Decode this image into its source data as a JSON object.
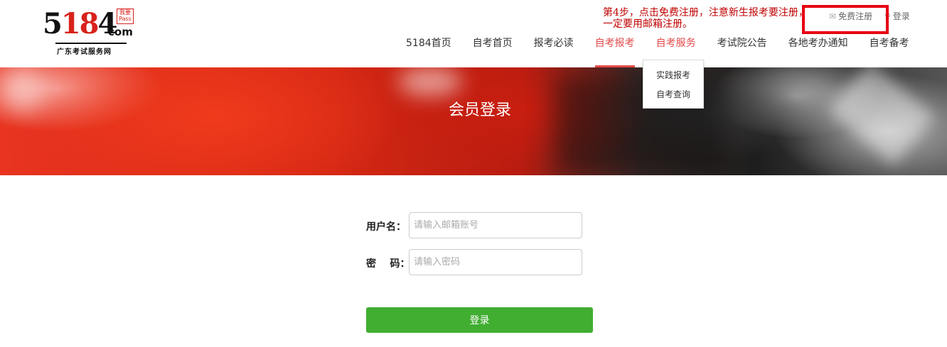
{
  "logo": {
    "digits_black_1": "5",
    "digits_red": "18",
    "digits_black_2": "4",
    "domain": "com",
    "stamp": "我要Pass",
    "slogan": "广东考试服务网"
  },
  "annotation": {
    "text": "第4步，点击免费注册，注意新生报考要注册，一定要用邮箱注册。"
  },
  "top_links": {
    "register": "免费注册",
    "login": "登录"
  },
  "nav": {
    "items": [
      {
        "label": "5184首页"
      },
      {
        "label": "自考首页"
      },
      {
        "label": "报考必读"
      },
      {
        "label": "自考报考"
      },
      {
        "label": "自考服务"
      },
      {
        "label": "考试院公告"
      },
      {
        "label": "各地考办通知"
      },
      {
        "label": "自考备考"
      }
    ],
    "dropdown": [
      "实践报考",
      "自考查询"
    ]
  },
  "banner": {
    "title": "会员登录"
  },
  "form": {
    "username_label": "用户名：",
    "username_placeholder": "请输入邮箱账号",
    "password_label": "密    码：",
    "password_placeholder": "请输入密码",
    "submit_label": "登录"
  },
  "colors": {
    "accent_red": "#e24b4b",
    "annotation_red": "#c00000",
    "highlight_box": "#e60012",
    "button_green": "#41ad31"
  }
}
